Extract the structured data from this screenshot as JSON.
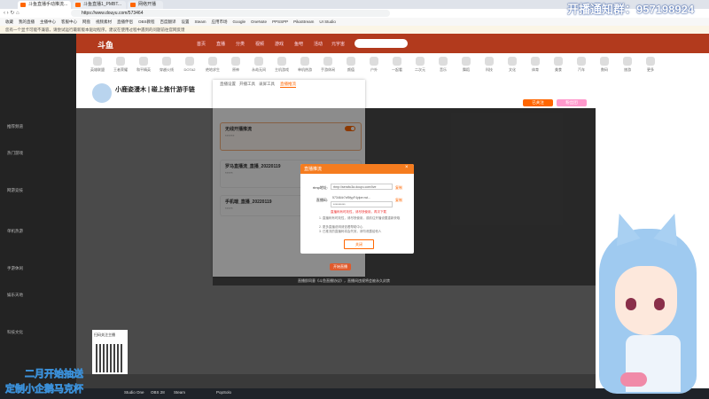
{
  "browser": {
    "tabs": [
      {
        "label": "斗鱼直播手动推流..."
      },
      {
        "label": "斗鱼直播1_PMBT..."
      },
      {
        "label": "网络开播"
      }
    ],
    "url": "https://www.douyu.com/573464"
  },
  "bookmarks": [
    "收藏",
    "我的直播",
    "主播中心",
    "客服中心",
    "网盘",
    "视频素材",
    "直播伴侣",
    "OBS教程",
    "百度翻译",
    "设置",
    "Steam",
    "应用市场",
    "Google",
    "OneNote",
    "PPSSPP",
    "PikaStream",
    "UI Studio"
  ],
  "notice": "您有一个显卡可能不兼容，请尝试运行最新版本驱动程序。建议在使用过程中遇到的问题前往官网反馈",
  "watermark": "开播通知群：957198924",
  "site": {
    "logo": "斗鱼",
    "nav": [
      "首页",
      "直播",
      "分类",
      "视频",
      "游戏",
      "鱼吧",
      "活动",
      "元宇宙"
    ],
    "categories": [
      "英雄联盟",
      "王者荣耀",
      "和平精英",
      "穿越火线",
      "DOTA2",
      "绝地求生",
      "原神",
      "永劫无间",
      "主机游戏",
      "单机热游",
      "手游休闲",
      "颜值",
      "户外",
      "一起看",
      "二次元",
      "音乐",
      "舞蹈",
      "科技",
      "文化",
      "体育",
      "美食",
      "汽车",
      "数码",
      "旅游",
      "更多"
    ],
    "streamer_title": "小鹿姿漫木 | 碰上推什游手链",
    "right_buttons": [
      "已关注",
      "粉丝团"
    ]
  },
  "sidebar": {
    "sections": [
      "推荐频道",
      "热门游戏",
      "网游竞技",
      "单机热游",
      "手游休闲",
      "娱乐天地",
      "科技文化"
    ]
  },
  "settings": {
    "tabs": [
      "直播设置",
      "开播工具",
      "录屏工具",
      "直播推流"
    ],
    "cards": [
      {
        "title": "无线开播推流",
        "sub": "******",
        "toggle": true
      },
      {
        "title": "罗马直播流_直播_20220119",
        "sub": "*****",
        "toggle": false
      },
      {
        "title": "手机端_直播_20220119",
        "sub": "*****",
        "toggle": false
      }
    ],
    "start_button": "开始直播",
    "agreement": "直播即同意《斗鱼直播协议》，直播间违规将会被永久封禁"
  },
  "modal": {
    "title": "直播推流",
    "rtmp_label": "rtmp地址:",
    "rtmp_value": "rtmp://sendtc3a.douyu.com/live",
    "key_label": "直播码:",
    "key_value": "573464r7cf5fyyF4ylpe=wt...",
    "key_mask": "**********",
    "copy": "复制",
    "warning": "直播码有时效性，请尽快使用，再次下载",
    "notes": [
      "1. 直播码有时效性，请尽快使用，或前往开播设置重新获取",
      "2. 更多直播说明请查看帮助中心",
      "3. 已推流的直播码将会失效，请勿泄露给他人"
    ],
    "ok": "关闭"
  },
  "qr": {
    "label": "扫码关注主播"
  },
  "taskbar": [
    "Studio One",
    "OBS 28",
    "Steam",
    "PopSolo"
  ],
  "banner": {
    "line1": "二月开始抽送",
    "line2": "定制小企鹅马克杯"
  }
}
